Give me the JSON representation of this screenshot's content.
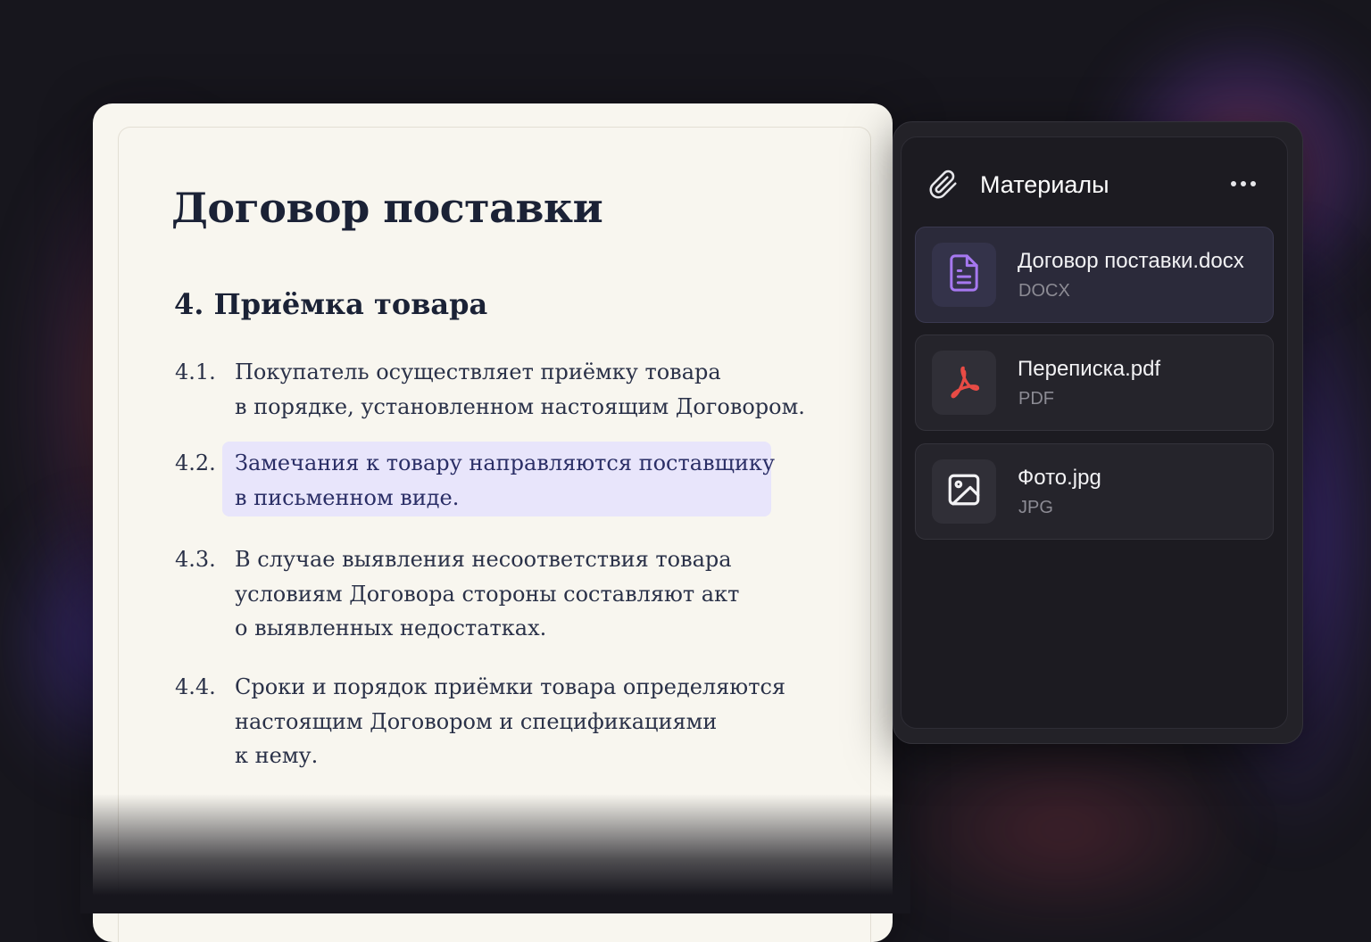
{
  "document": {
    "title": "Договор поставки",
    "section_title": "4. Приёмка товара",
    "clauses": [
      {
        "num": "4.1.",
        "lines": [
          "Покупатель осуществляет приёмку товара",
          "в порядке, установленном настоящим Договором."
        ]
      },
      {
        "num": "4.2.",
        "lines": [
          "Замечания к товару направляются поставщику",
          "в письменном виде."
        ],
        "highlighted": true
      },
      {
        "num": "4.3.",
        "lines": [
          "В случае выявления несоответствия товара",
          "условиям Договора стороны составляют акт",
          "о выявленных недостатках."
        ]
      },
      {
        "num": "4.4.",
        "lines": [
          "Сроки и порядок приёмки товара определяются",
          "настоящим Договором и спецификациями",
          "к нему."
        ]
      }
    ]
  },
  "materials": {
    "icon": "paperclip-icon",
    "title": "Материалы",
    "more_icon": "more-horizontal-icon",
    "files": [
      {
        "name": "Договор поставки.docx",
        "type": "DOCX",
        "icon": "document-icon",
        "color": "#a678f0",
        "active": true
      },
      {
        "name": "Переписка.pdf",
        "type": "PDF",
        "icon": "pdf-icon",
        "color": "#e84b45"
      },
      {
        "name": "Фото.jpg",
        "type": "JPG",
        "icon": "image-icon",
        "color": "#f2f2f4"
      }
    ]
  }
}
